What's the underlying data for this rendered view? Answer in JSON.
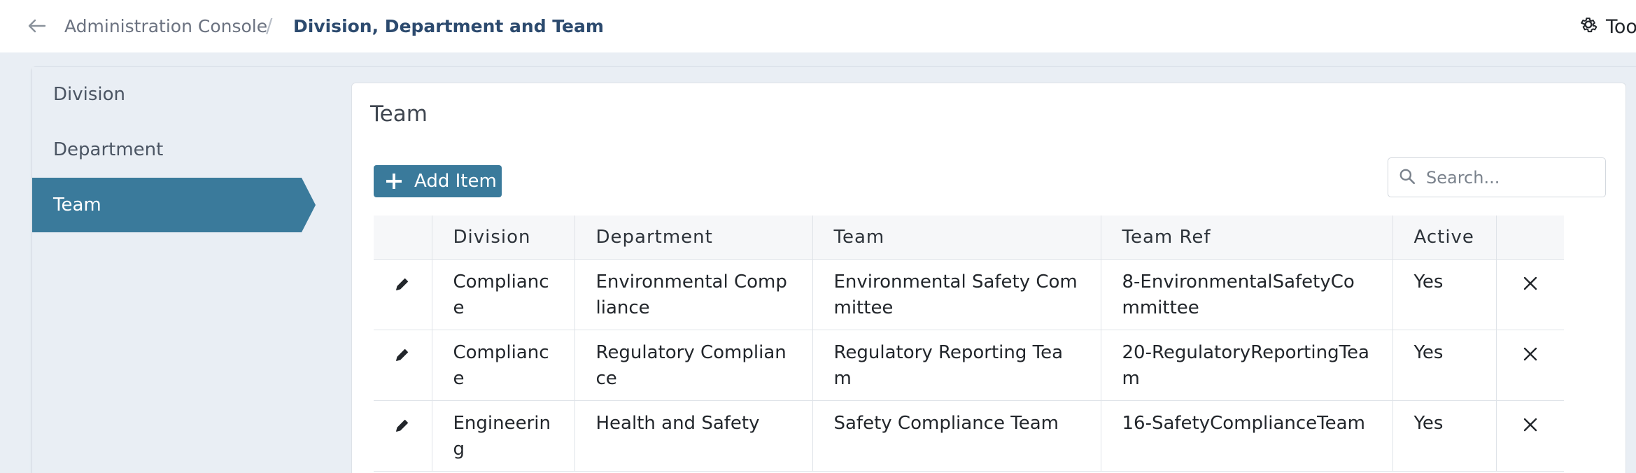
{
  "breadcrumb": {
    "root": "Administration Console",
    "separator": "/",
    "current": "Division, Department and Team"
  },
  "toolbar": {
    "tools_label": "Too"
  },
  "sidebar": {
    "items": [
      {
        "label": "Division",
        "active": false
      },
      {
        "label": "Department",
        "active": false
      },
      {
        "label": "Team",
        "active": true
      }
    ]
  },
  "panel": {
    "title": "Team",
    "add_button_label": "Add Item",
    "search_placeholder": "Search..."
  },
  "table": {
    "columns": [
      "Division",
      "Department",
      "Team",
      "Team Ref",
      "Active"
    ],
    "rows": [
      {
        "division": "Compliance",
        "department": "Environmental Compliance",
        "team": "Environmental Safety Committee",
        "team_ref": "8-EnvironmentalSafetyCommittee",
        "active": "Yes"
      },
      {
        "division": "Compliance",
        "department": "Regulatory Compliance",
        "team": "Regulatory Reporting Team",
        "team_ref": "20-RegulatoryReportingTeam",
        "active": "Yes"
      },
      {
        "division": "Engineering",
        "department": "Health and Safety",
        "team": "Safety Compliance Team",
        "team_ref": "16-SafetyComplianceTeam",
        "active": "Yes"
      }
    ]
  },
  "colors": {
    "accent": "#3a7a9b",
    "breadcrumb_current": "#2c4a6e",
    "background": "#e9eef4"
  }
}
